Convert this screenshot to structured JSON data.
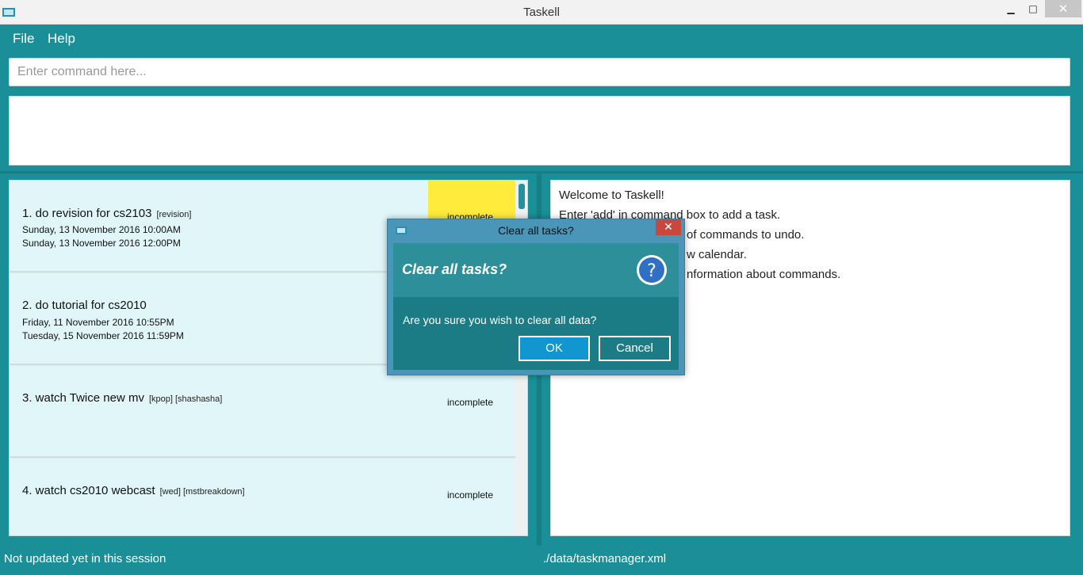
{
  "window": {
    "title": "Taskell",
    "minimize_glyph": "▁",
    "maximize_glyph": "□",
    "close_glyph": "✕"
  },
  "menu": {
    "file": "File",
    "help": "Help"
  },
  "command": {
    "placeholder": "Enter command here..."
  },
  "tasks": [
    {
      "name": "1. do revision for cs2103",
      "tags": "[revision]",
      "start": "Sunday, 13 November 2016  10:00AM",
      "end": "Sunday, 13 November 2016  12:00PM",
      "status": "incomplete"
    },
    {
      "name": "2. do tutorial for cs2010",
      "tags": "",
      "start": "Friday, 11 November 2016  10:55PM",
      "end": "Tuesday, 15 November 2016  11:59PM",
      "status": ""
    },
    {
      "name": "3. watch Twice new mv",
      "tags": "[kpop] [shashasha]",
      "start": "",
      "end": "",
      "status": "incomplete"
    },
    {
      "name": "4. watch cs2010 webcast",
      "tags": "[wed] [mstbreakdown]",
      "start": "",
      "end": "",
      "status": "incomplete"
    }
  ],
  "welcome": {
    "lines": [
      "Welcome to Taskell!",
      "Enter 'add' in command box to add a task.",
      "of commands to undo.",
      "w calendar.",
      "nformation about commands."
    ]
  },
  "statusbar": {
    "sync": "Not updated yet in this session",
    "path": "./data/taskmanager.xml"
  },
  "dialog": {
    "title": "Clear all tasks?",
    "heading": "Clear all tasks?",
    "message": "Are you sure you wish to clear all data?",
    "ok_label": "OK",
    "cancel_label": "Cancel",
    "close_glyph": "✕",
    "icon": "question-icon"
  },
  "colors": {
    "accent": "#1a8f97",
    "card": "#e0f6f8",
    "highlight": "#ffeb3b",
    "dialog_ok": "#1296d0",
    "dialog_close": "#c9473e"
  }
}
